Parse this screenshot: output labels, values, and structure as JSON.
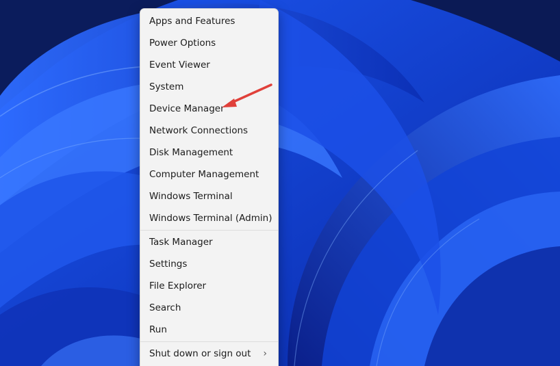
{
  "menu": {
    "group1": [
      {
        "name": "menu-item-apps-and-features",
        "label": "Apps and Features"
      },
      {
        "name": "menu-item-power-options",
        "label": "Power Options"
      },
      {
        "name": "menu-item-event-viewer",
        "label": "Event Viewer"
      },
      {
        "name": "menu-item-system",
        "label": "System"
      },
      {
        "name": "menu-item-device-manager",
        "label": "Device Manager"
      },
      {
        "name": "menu-item-network-connections",
        "label": "Network Connections"
      },
      {
        "name": "menu-item-disk-management",
        "label": "Disk Management"
      },
      {
        "name": "menu-item-computer-management",
        "label": "Computer Management"
      },
      {
        "name": "menu-item-windows-terminal",
        "label": "Windows Terminal"
      },
      {
        "name": "menu-item-windows-terminal-admin",
        "label": "Windows Terminal (Admin)"
      }
    ],
    "group2": [
      {
        "name": "menu-item-task-manager",
        "label": "Task Manager"
      },
      {
        "name": "menu-item-settings",
        "label": "Settings"
      },
      {
        "name": "menu-item-file-explorer",
        "label": "File Explorer"
      },
      {
        "name": "menu-item-search",
        "label": "Search"
      },
      {
        "name": "menu-item-run",
        "label": "Run"
      }
    ],
    "group3": [
      {
        "name": "menu-item-shut-down-or-sign-out",
        "label": "Shut down or sign out",
        "has_submenu": true
      }
    ],
    "submenu_icon": "chevron-right-icon",
    "submenu_glyph": "›"
  },
  "annotation": {
    "color": "#e0403a",
    "target": "Device Manager"
  },
  "wallpaper": {
    "base_color": "#0a2fb8",
    "accent_color": "#3f7dff"
  }
}
